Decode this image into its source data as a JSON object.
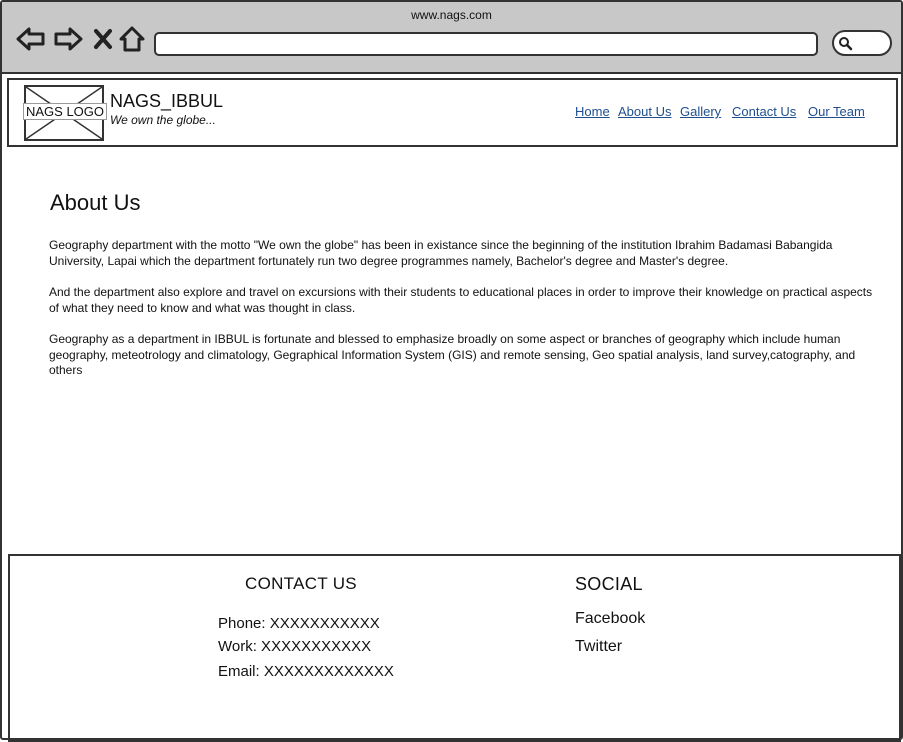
{
  "browser": {
    "url_title": "www.nags.com",
    "address_value": ""
  },
  "header": {
    "logo_text": "NAGS LOGO",
    "brand_name": "NAGS_IBBUL",
    "tagline": "We own the globe...",
    "nav": [
      "Home",
      "About Us",
      "Gallery",
      "Contact Us",
      "Our Team"
    ],
    "link_color": "#1f4f8f"
  },
  "main": {
    "title": "About Us",
    "paragraphs": [
      "Geography department with the motto \"We own the globe\" has been in existance since the beginning of the institution Ibrahim Badamasi Babangida University, Lapai which the department fortunately run two degree programmes namely, Bachelor's degree and Master's degree.",
      "And the department also explore and travel on excursions with their students to educational places in order to improve their knowledge on practical aspects of what they need to know and what was thought in class.",
      "Geography as a department in IBBUL is fortunate and blessed to emphasize broadly on some aspect or branches of geography which include human geography, meteotrology and climatology, Gegraphical Information System (GIS) and remote sensing, Geo spatial analysis, land survey,catography, and others"
    ]
  },
  "footer": {
    "contact_heading": "CONTACT US",
    "phone": "Phone: XXXXXXXXXXX",
    "work": "Work: XXXXXXXXXXX",
    "email": "Email: XXXXXXXXXXXXX",
    "social_heading": "SOCIAL",
    "social_links": [
      "Facebook",
      "Twitter"
    ]
  }
}
